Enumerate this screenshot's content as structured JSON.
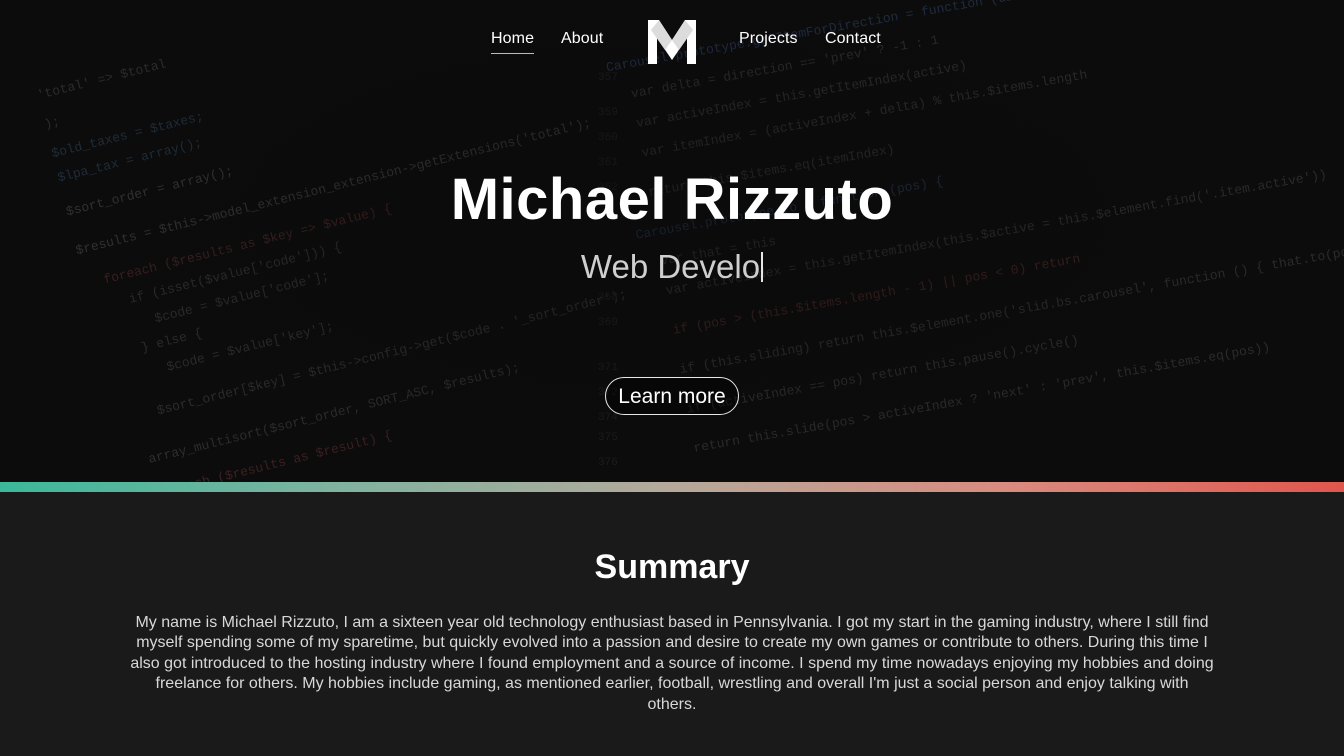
{
  "nav": {
    "items": [
      {
        "label": "Home",
        "active": true
      },
      {
        "label": "About",
        "active": false
      },
      {
        "label": "Projects",
        "active": false
      },
      {
        "label": "Contact",
        "active": false
      }
    ],
    "logo_icon": "m-logo-icon"
  },
  "hero": {
    "title": "Michael Rizzuto",
    "subtitle": "Web Develo",
    "button_label": "Learn more"
  },
  "summary": {
    "title": "Summary",
    "text": "My name is Michael Rizzuto, I am a sixteen year old technology enthusiast based in Pennsylvania. I got my start in the gaming industry, where I still find myself spending some of my sparetime, but quickly evolved into a passion and desire to create my own games or contribute to others. During this time I also got introduced to the hosting industry where I found employment and a source of income. I spend my time nowadays enjoying my hobbies and doing freelance for others. My hobbies include gaming, as mentioned earlier, football, wrestling and overall I'm just a social person and enjoy talking with others."
  },
  "colors": {
    "accent_start": "#3bb89a",
    "accent_end": "#e0564d",
    "background": "#1a1a1a"
  }
}
